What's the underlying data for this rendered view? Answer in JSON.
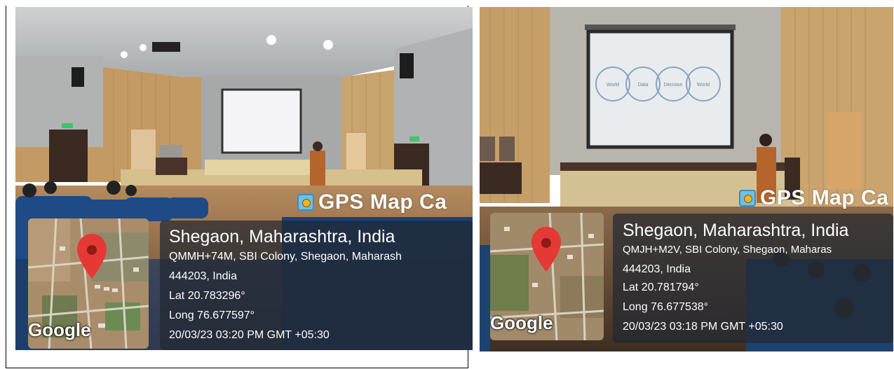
{
  "photos": [
    {
      "app_title": "GPS Map Ca",
      "location": "Shegaon, Maharashtra, India",
      "address_line1": "QMMH+74M, SBI Colony, Shegaon, Maharash",
      "address_line2": "444203, India",
      "lat": "Lat 20.783296°",
      "long": "Long 76.677597°",
      "datetime": "20/03/23 03:20 PM GMT +05:30",
      "map_brand": "Google"
    },
    {
      "app_title": "GPS Map Ca",
      "location": "Shegaon, Maharashtra, India",
      "address_line1": "QMJH+M2V, SBI Colony, Shegaon, Maharas",
      "address_line2": "444203, India",
      "lat": "Lat 20.781794°",
      "long": "Long 76.677538°",
      "datetime": "20/03/23 03:18 PM GMT +05:30",
      "map_brand": "Google",
      "slide_labels": [
        "World",
        "Data",
        "Decision",
        "World"
      ]
    }
  ],
  "colors": {
    "pin": "#e53935",
    "panel": "#23283288",
    "wood": "#c9a46e",
    "seat_blue": "#1f4e8c"
  }
}
